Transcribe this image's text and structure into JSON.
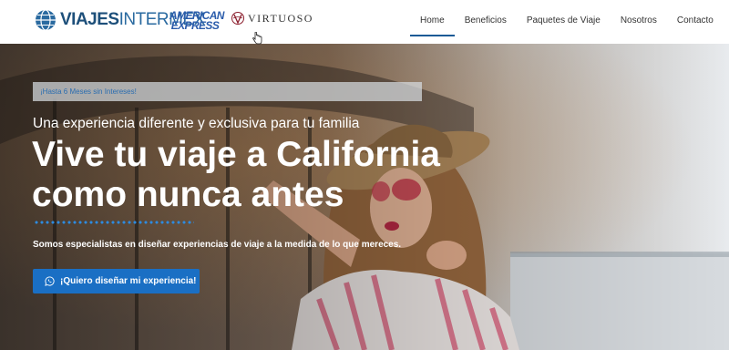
{
  "header": {
    "logo_brand": "VIAJES",
    "logo_brand2": "INTERMEX",
    "amex_line1": "AMERICAN",
    "amex_line2": "EXPRESS",
    "virtuoso": "VIRTUOSO"
  },
  "nav": {
    "items": [
      {
        "label": "Home"
      },
      {
        "label": "Beneficios"
      },
      {
        "label": "Paquetes de Viaje"
      },
      {
        "label": "Nosotros"
      },
      {
        "label": "Contacto"
      }
    ]
  },
  "hero": {
    "badge": "¡Hasta 6 Meses sin Intereses!",
    "subtitle": "Una experiencia diferente y exclusiva para tu familia",
    "title_line1": "Vive tu viaje a California",
    "title_line2": "como nunca antes",
    "description": "Somos especialistas en diseñar experiencias de viaje a la medida de lo que mereces.",
    "cta": "¡Quiero diseñar mi experiencia!"
  },
  "colors": {
    "accent": "#1a6fc4",
    "nav_underline": "#1a5a96",
    "badge_text": "#2a6db0"
  }
}
